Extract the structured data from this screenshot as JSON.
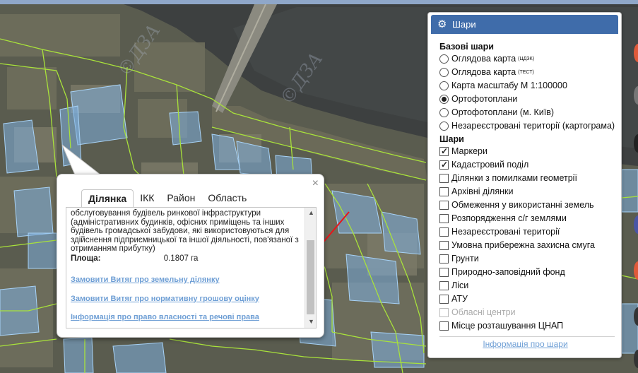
{
  "watermark": "©ДЗА",
  "popup": {
    "close_glyph": "×",
    "tabs": [
      "Ділянка",
      "ІКК",
      "Район",
      "Область"
    ],
    "description": "обслуговування будівель ринкової інфраструктури (адміністративних будинків, офісних приміщень та інших будівель громадської забудови, які використовуються для здійснення підприємницької та іншої діяльності, пов'язаної з отриманням прибутку)",
    "area_label": "Площа:",
    "area_value": "0.1807 га",
    "links": [
      "Замовити Витяг про земельну ділянку",
      "Замовити Витяг про нормативну грошову оцінку",
      "Інформація про право власності та речові права"
    ],
    "scroll_up": "▲",
    "scroll_down": "▼"
  },
  "layers": {
    "title": "Шари",
    "gear_icon": "⚙",
    "base_title": "Базові шари",
    "base": [
      {
        "label": "Оглядова карта",
        "sup": "(ЦДЗК)",
        "selected": false
      },
      {
        "label": "Оглядова карта",
        "sup": "(ТЕСТ)",
        "selected": false
      },
      {
        "label": "Карта масштабу М 1:100000",
        "sup": "",
        "selected": false
      },
      {
        "label": "Ортофотоплани",
        "sup": "",
        "selected": true
      },
      {
        "label": "Ортофотоплани (м. Київ)",
        "sup": "",
        "selected": false
      },
      {
        "label": "Незареєстровані території (картограма)",
        "sup": "",
        "selected": false
      }
    ],
    "overlay_title": "Шари",
    "overlays": [
      {
        "label": "Маркери",
        "checked": true,
        "disabled": false
      },
      {
        "label": "Кадастровий поділ",
        "checked": true,
        "disabled": false
      },
      {
        "label": "Ділянки з помилками геометрії",
        "checked": false,
        "disabled": false
      },
      {
        "label": "Архівні ділянки",
        "checked": false,
        "disabled": false
      },
      {
        "label": "Обмеження у використанні земель",
        "checked": false,
        "disabled": false
      },
      {
        "label": "Розпорядження с/г землями",
        "checked": false,
        "disabled": false
      },
      {
        "label": "Незареєстровані території",
        "checked": false,
        "disabled": false
      },
      {
        "label": "Умовна прибережна захисна смуга",
        "checked": false,
        "disabled": false
      },
      {
        "label": "Грунти",
        "checked": false,
        "disabled": false
      },
      {
        "label": "Природно-заповідний фонд",
        "checked": false,
        "disabled": false
      },
      {
        "label": "Ліси",
        "checked": false,
        "disabled": false
      },
      {
        "label": "АТУ",
        "checked": false,
        "disabled": false
      },
      {
        "label": "Обласні центри",
        "checked": false,
        "disabled": true
      },
      {
        "label": "Місце розташування ЦНАП",
        "checked": false,
        "disabled": false
      }
    ],
    "info_link": "Інформація про шари"
  },
  "colors": {
    "header_blue": "#3f6caa",
    "link_blue": "#6f9fd5",
    "parcel_line": "#a9e23b",
    "parcel_fill": "#7fb0e0",
    "annotation_arrow": "#e8151a"
  }
}
